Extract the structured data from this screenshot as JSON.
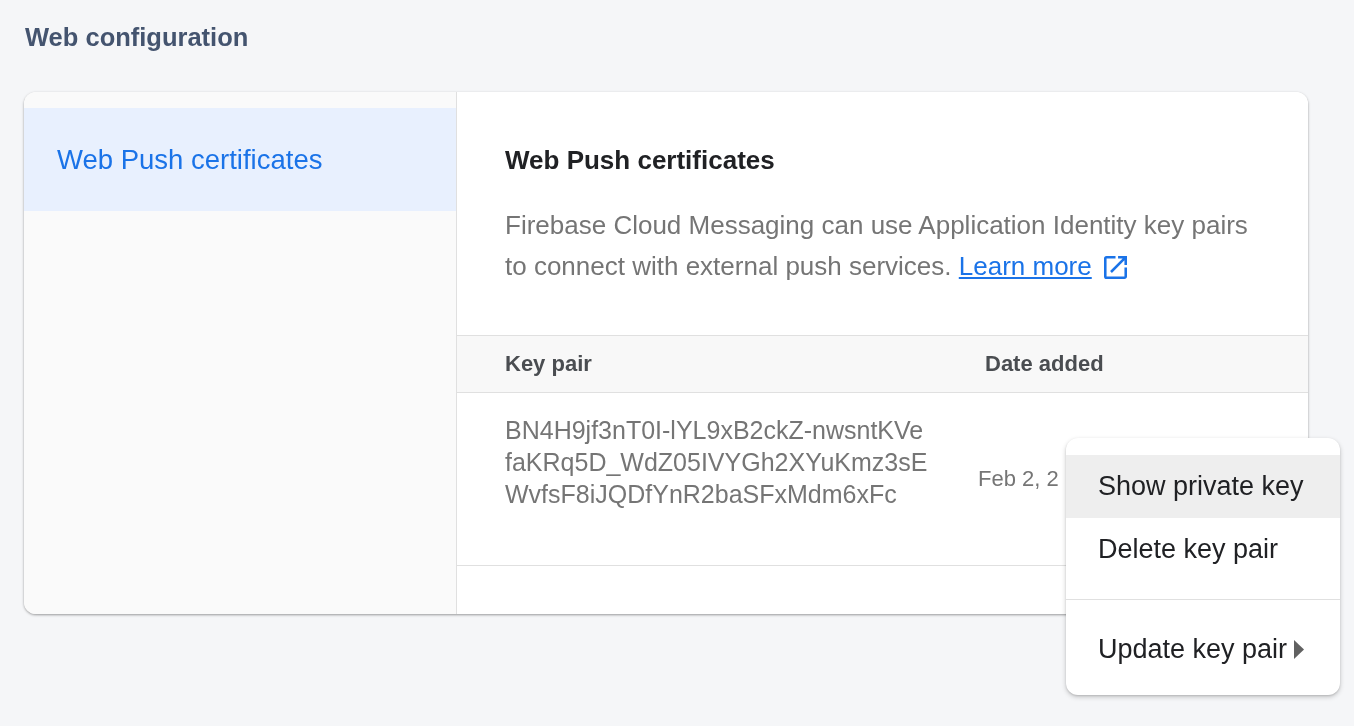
{
  "page": {
    "title": "Web configuration"
  },
  "sidebar": {
    "items": [
      {
        "label": "Web Push certificates",
        "selected": true
      }
    ]
  },
  "panel": {
    "title": "Web Push certificates",
    "description": "Firebase Cloud Messaging can use Application Identity key pairs to connect with external push services.",
    "link": "Learn more"
  },
  "table": {
    "columns": [
      "Key pair",
      "Date added"
    ],
    "rows": [
      {
        "cells": [
          "BN4H9jf3nT0I-lYL9xB2ckZ-nwsntKVefaKRq5D_WdZ05IVYGh2XYuKmz3sEWvfsF8iJQDfYnR2baSFxMdm6xFc",
          "Feb 2, 2"
        ]
      }
    ]
  },
  "context_menu": {
    "groups": [
      {
        "items": [
          {
            "label": "Show private key",
            "selected": true,
            "submenu": false
          },
          {
            "label": "Delete key pair",
            "selected": false,
            "submenu": false
          }
        ]
      },
      {
        "items": [
          {
            "label": "Update key pair",
            "selected": false,
            "submenu": true
          }
        ]
      }
    ]
  }
}
